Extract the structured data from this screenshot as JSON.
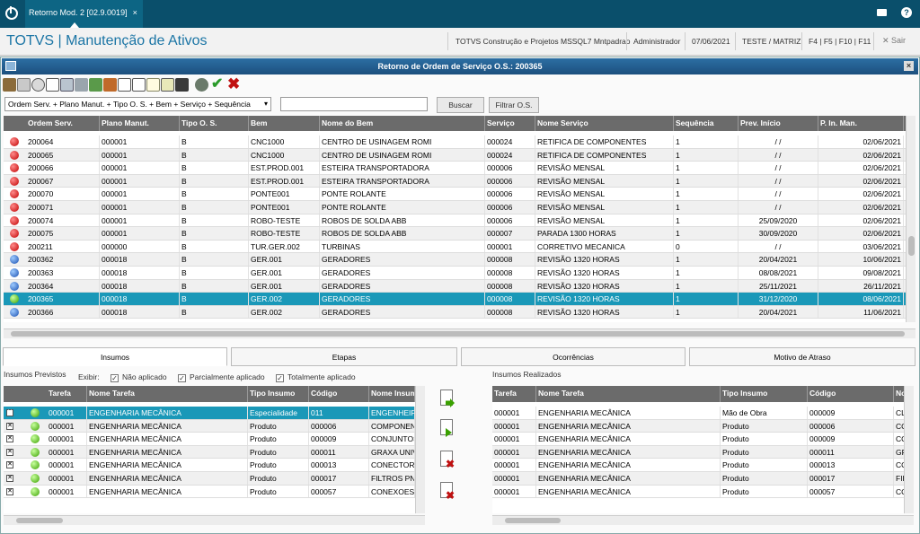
{
  "topbar": {
    "tab_label": "Retorno Mod. 2 [02.9.0019]",
    "tab_close": "×",
    "help": "?"
  },
  "header": {
    "title": "TOTVS | Manutenção de Ativos",
    "company": "TOTVS Construção e Projetos MSSQL7 Mntpadrao",
    "user": "Administrador",
    "date": "07/06/2021",
    "branch": "TESTE / MATRIZ",
    "keys": "F4 | F5 | F10 | F11",
    "exit": "✕ Sair"
  },
  "dialog": {
    "title": "Retorno de Ordem de Serviço O.S.: 200365",
    "close": "×"
  },
  "filter": {
    "index_value": "Ordem Serv. + Plano Manut. + Tipo O. S. + Bem + Serviço + Sequência",
    "arrow": "▾",
    "search_label": "Buscar",
    "filter_label": "Filtrar O.S."
  },
  "os_grid": {
    "columns": [
      "Ordem Serv.",
      "Plano Manut.",
      "Tipo O. S.",
      "Bem",
      "Nome do Bem",
      "Serviço",
      "Nome Serviço",
      "Sequência",
      "Prev. Início",
      "P. In. Man."
    ],
    "rows": [
      {
        "status": "red",
        "c": [
          "200064",
          "000001",
          "B",
          "CNC1000",
          "CENTRO DE USINAGEM ROMI",
          "000024",
          "RETIFICA DE COMPONENTES",
          "1",
          " /  /",
          "02/06/2021"
        ]
      },
      {
        "status": "red",
        "c": [
          "200065",
          "000001",
          "B",
          "CNC1000",
          "CENTRO DE USINAGEM ROMI",
          "000024",
          "RETIFICA DE COMPONENTES",
          "1",
          " /  /",
          "02/06/2021"
        ]
      },
      {
        "status": "red",
        "c": [
          "200066",
          "000001",
          "B",
          "EST.PROD.001",
          "ESTEIRA TRANSPORTADORA",
          "000006",
          "REVISÃO MENSAL",
          "1",
          " /  /",
          "02/06/2021"
        ]
      },
      {
        "status": "red",
        "c": [
          "200067",
          "000001",
          "B",
          "EST.PROD.001",
          "ESTEIRA TRANSPORTADORA",
          "000006",
          "REVISÃO MENSAL",
          "1",
          " /  /",
          "02/06/2021"
        ]
      },
      {
        "status": "red",
        "c": [
          "200070",
          "000001",
          "B",
          "PONTE001",
          "PONTE ROLANTE",
          "000006",
          "REVISÃO MENSAL",
          "1",
          " /  /",
          "02/06/2021"
        ]
      },
      {
        "status": "red",
        "c": [
          "200071",
          "000001",
          "B",
          "PONTE001",
          "PONTE ROLANTE",
          "000006",
          "REVISÃO MENSAL",
          "1",
          " /  /",
          "02/06/2021"
        ]
      },
      {
        "status": "red",
        "c": [
          "200074",
          "000001",
          "B",
          "ROBO-TESTE",
          "ROBOS DE SOLDA ABB",
          "000006",
          "REVISÃO MENSAL",
          "1",
          "25/09/2020",
          "02/06/2021"
        ]
      },
      {
        "status": "red",
        "c": [
          "200075",
          "000001",
          "B",
          "ROBO-TESTE",
          "ROBOS DE SOLDA ABB",
          "000007",
          "PARADA 1300 HORAS",
          "1",
          "30/09/2020",
          "02/06/2021"
        ]
      },
      {
        "status": "red",
        "c": [
          "200211",
          "000000",
          "B",
          "TUR.GER.002",
          "TURBINAS",
          "000001",
          "CORRETIVO MECANICA",
          "0",
          " /  /",
          "03/06/2021"
        ]
      },
      {
        "status": "blue",
        "c": [
          "200362",
          "000018",
          "B",
          "GER.001",
          "GERADORES",
          "000008",
          "REVISÃO 1320 HORAS",
          "1",
          "20/04/2021",
          "10/06/2021"
        ]
      },
      {
        "status": "blue",
        "c": [
          "200363",
          "000018",
          "B",
          "GER.001",
          "GERADORES",
          "000008",
          "REVISÃO 1320 HORAS",
          "1",
          "08/08/2021",
          "09/08/2021"
        ]
      },
      {
        "status": "blue",
        "c": [
          "200364",
          "000018",
          "B",
          "GER.001",
          "GERADORES",
          "000008",
          "REVISÃO 1320 HORAS",
          "1",
          "25/11/2021",
          "26/11/2021"
        ]
      },
      {
        "status": "green",
        "c": [
          "200365",
          "000018",
          "B",
          "GER.002",
          "GERADORES",
          "000008",
          "REVISÃO 1320 HORAS",
          "1",
          "31/12/2020",
          "08/06/2021"
        ]
      },
      {
        "status": "blue",
        "c": [
          "200366",
          "000018",
          "B",
          "GER.002",
          "GERADORES",
          "000008",
          "REVISÃO 1320 HORAS",
          "1",
          "20/04/2021",
          "11/06/2021"
        ]
      }
    ]
  },
  "tabs": [
    "Insumos",
    "Etapas",
    "Ocorrências",
    "Motivo de Atraso"
  ],
  "previstos": {
    "title": "Insumos Previstos",
    "show_label": "Exibir:",
    "options": [
      "Não aplicado",
      "Parcialmente aplicado",
      "Totalmente aplicado"
    ],
    "check": "✓",
    "columns": [
      "Tarefa",
      "Nome Tarefa",
      "Tipo Insumo",
      "Código",
      "Nome Insumo"
    ],
    "rows": [
      [
        "000001",
        "ENGENHARIA MECÂNICA",
        "Especialidade",
        "011",
        "ENGENHEIRO"
      ],
      [
        "000001",
        "ENGENHARIA MECÂNICA",
        "Produto",
        "000006",
        "COMPONENTE"
      ],
      [
        "000001",
        "ENGENHARIA MECÂNICA",
        "Produto",
        "000009",
        "CONJUNTOS"
      ],
      [
        "000001",
        "ENGENHARIA MECÂNICA",
        "Produto",
        "000011",
        "GRAXA UNIV"
      ],
      [
        "000001",
        "ENGENHARIA MECÂNICA",
        "Produto",
        "000013",
        "CONECTORES"
      ],
      [
        "000001",
        "ENGENHARIA MECÂNICA",
        "Produto",
        "000017",
        "FILTROS PNE"
      ],
      [
        "000001",
        "ENGENHARIA MECÂNICA",
        "Produto",
        "000057",
        "CONEXOES P"
      ]
    ]
  },
  "realizados": {
    "title": "Insumos Realizados",
    "columns": [
      "Tarefa",
      "Nome Tarefa",
      "Tipo Insumo",
      "Código",
      "No"
    ],
    "rows": [
      [
        "000001",
        "ENGENHARIA MECÂNICA",
        "Mão de Obra",
        "000009",
        "CL"
      ],
      [
        "000001",
        "ENGENHARIA MECÂNICA",
        "Produto",
        "000006",
        "CC"
      ],
      [
        "000001",
        "ENGENHARIA MECÂNICA",
        "Produto",
        "000009",
        "CC"
      ],
      [
        "000001",
        "ENGENHARIA MECÂNICA",
        "Produto",
        "000011",
        "GF"
      ],
      [
        "000001",
        "ENGENHARIA MECÂNICA",
        "Produto",
        "000013",
        "CC"
      ],
      [
        "000001",
        "ENGENHARIA MECÂNICA",
        "Produto",
        "000017",
        "FIL"
      ],
      [
        "000001",
        "ENGENHARIA MECÂNICA",
        "Produto",
        "000057",
        "CC"
      ]
    ]
  },
  "icons": {
    "toolbar": [
      "edit-icon",
      "print-icon",
      "help-icon",
      "preview-icon",
      "copy-icon",
      "print2-icon",
      "tools-icon",
      "tools2-icon",
      "document-icon",
      "document2-icon",
      "report-icon",
      "list-icon",
      "save-icon",
      "process-icon",
      "confirm-icon",
      "cancel-icon"
    ]
  }
}
